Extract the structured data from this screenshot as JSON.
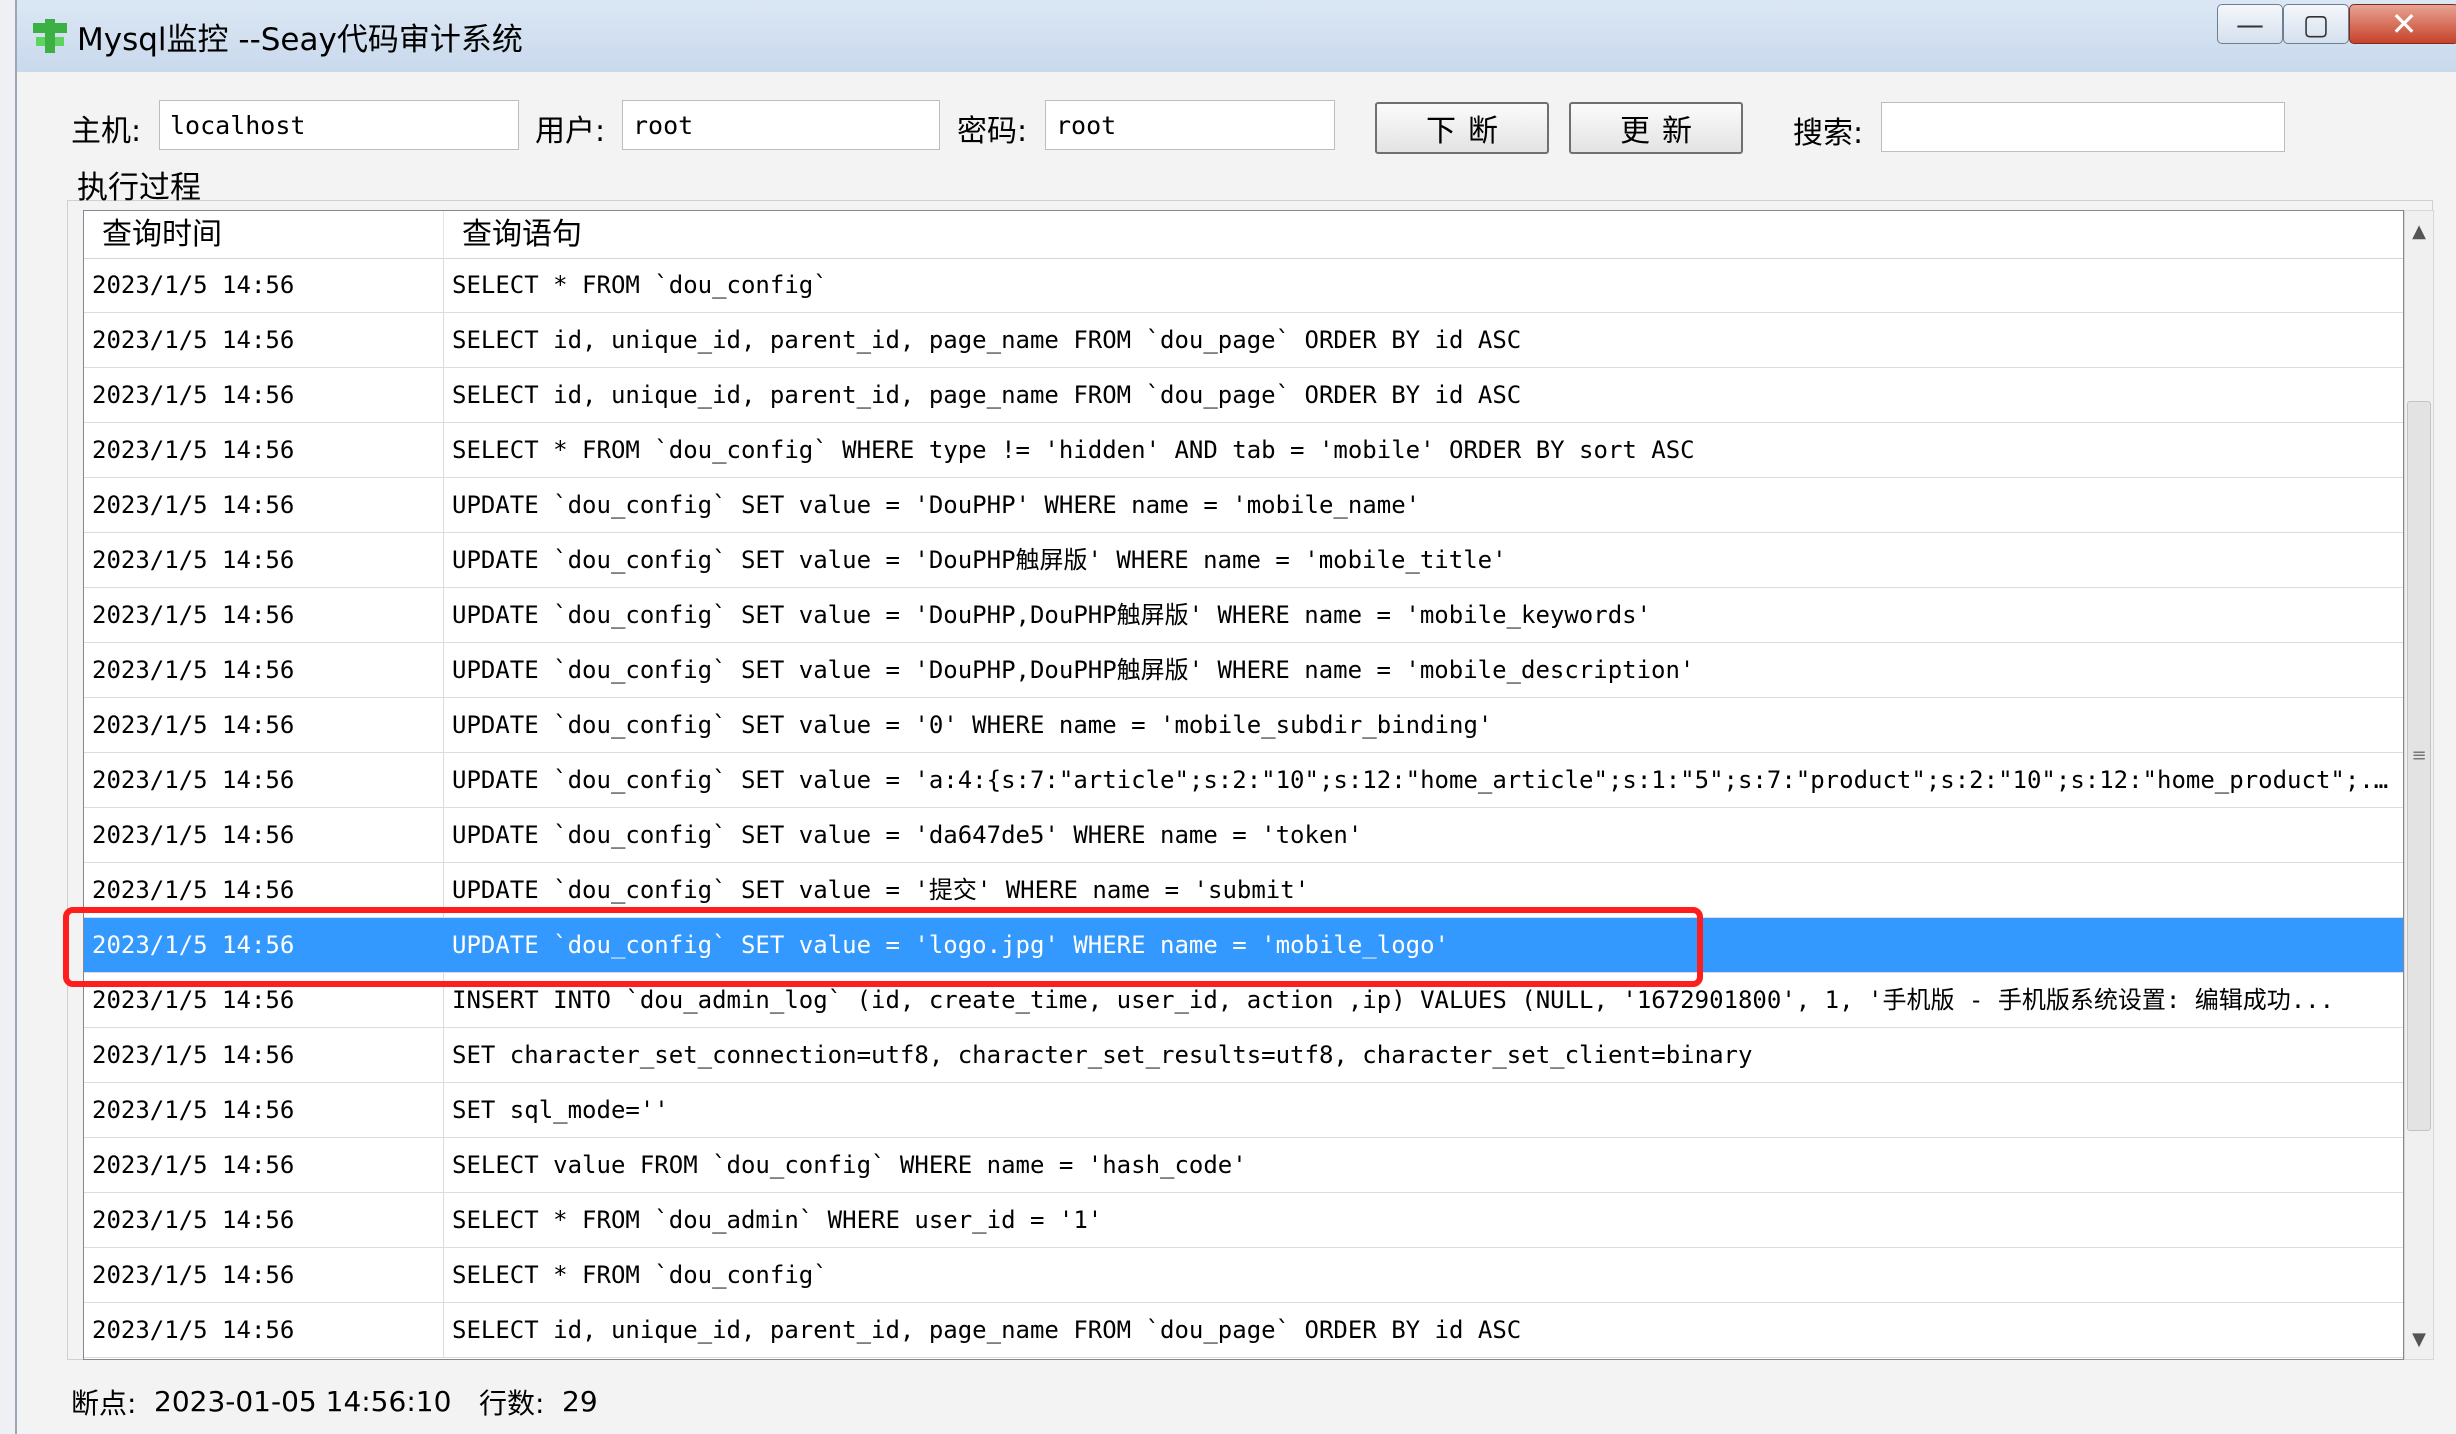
{
  "window": {
    "title": "Mysql监控 --Seay代码审计系统",
    "icons": {
      "app": "seay-app-icon",
      "minimize": "minimize-icon",
      "maximize": "maximize-icon",
      "close": "close-icon"
    },
    "min_glyph": "—",
    "max_glyph": "▢",
    "close_glyph": "✕"
  },
  "toolbar": {
    "host_label": "主机:",
    "host_value": "localhost",
    "user_label": "用户:",
    "user_value": "root",
    "password_label": "密码:",
    "password_value": "root",
    "break_label": "下断",
    "update_label": "更新",
    "search_label": "搜索:",
    "search_value": ""
  },
  "group": {
    "label": "执行过程"
  },
  "table": {
    "columns": [
      "查询时间",
      "查询语句"
    ],
    "rows": [
      {
        "time": "2023/1/5 14:56",
        "query": "SELECT * FROM `dou_config`"
      },
      {
        "time": "2023/1/5 14:56",
        "query": "SELECT id, unique_id, parent_id, page_name FROM `dou_page` ORDER BY id ASC"
      },
      {
        "time": "2023/1/5 14:56",
        "query": "SELECT id, unique_id, parent_id, page_name FROM `dou_page` ORDER BY id ASC"
      },
      {
        "time": "2023/1/5 14:56",
        "query": "SELECT * FROM `dou_config` WHERE type != 'hidden' AND tab = 'mobile' ORDER BY sort ASC"
      },
      {
        "time": "2023/1/5 14:56",
        "query": "UPDATE `dou_config` SET value = 'DouPHP' WHERE name = 'mobile_name'"
      },
      {
        "time": "2023/1/5 14:56",
        "query": "UPDATE `dou_config` SET value = 'DouPHP触屏版' WHERE name = 'mobile_title'"
      },
      {
        "time": "2023/1/5 14:56",
        "query": "UPDATE `dou_config` SET value = 'DouPHP,DouPHP触屏版' WHERE name = 'mobile_keywords'"
      },
      {
        "time": "2023/1/5 14:56",
        "query": "UPDATE `dou_config` SET value = 'DouPHP,DouPHP触屏版' WHERE name = 'mobile_description'"
      },
      {
        "time": "2023/1/5 14:56",
        "query": "UPDATE `dou_config` SET value = '0' WHERE name = 'mobile_subdir_binding'"
      },
      {
        "time": "2023/1/5 14:56",
        "query": "UPDATE `dou_config` SET value = 'a:4:{s:7:\"article\";s:2:\"10\";s:12:\"home_article\";s:1:\"5\";s:7:\"product\";s:2:\"10\";s:12:\"home_product\";..."
      },
      {
        "time": "2023/1/5 14:56",
        "query": "UPDATE `dou_config` SET value = 'da647de5' WHERE name = 'token'"
      },
      {
        "time": "2023/1/5 14:56",
        "query": "UPDATE `dou_config` SET value = '提交' WHERE name = 'submit'"
      },
      {
        "time": "2023/1/5 14:56",
        "query": "UPDATE `dou_config` SET value = 'logo.jpg' WHERE name = 'mobile_logo'",
        "selected": true
      },
      {
        "time": "2023/1/5 14:56",
        "query": "INSERT INTO `dou_admin_log` (id, create_time, user_id, action ,ip) VALUES (NULL, '1672901800', 1, '手机版 - 手机版系统设置: 编辑成功..."
      },
      {
        "time": "2023/1/5 14:56",
        "query": "SET character_set_connection=utf8, character_set_results=utf8, character_set_client=binary"
      },
      {
        "time": "2023/1/5 14:56",
        "query": "SET sql_mode=''"
      },
      {
        "time": "2023/1/5 14:56",
        "query": "SELECT value FROM `dou_config` WHERE name = 'hash_code'"
      },
      {
        "time": "2023/1/5 14:56",
        "query": "SELECT * FROM `dou_admin` WHERE user_id = '1'"
      },
      {
        "time": "2023/1/5 14:56",
        "query": "SELECT * FROM `dou_config`"
      },
      {
        "time": "2023/1/5 14:56",
        "query": "SELECT id, unique_id, parent_id, page_name FROM `dou_page` ORDER BY id ASC"
      }
    ]
  },
  "scrollbar": {
    "up_glyph": "▲",
    "down_glyph": "▼",
    "grip_glyph": "≡"
  },
  "status": {
    "breakpoint_label": "断点:",
    "breakpoint_value": "2023-01-05 14:56:10",
    "rows_label": "行数:",
    "rows_value": "29"
  },
  "colors": {
    "selection": "#3399ff",
    "highlight": "#ff1e1e"
  }
}
